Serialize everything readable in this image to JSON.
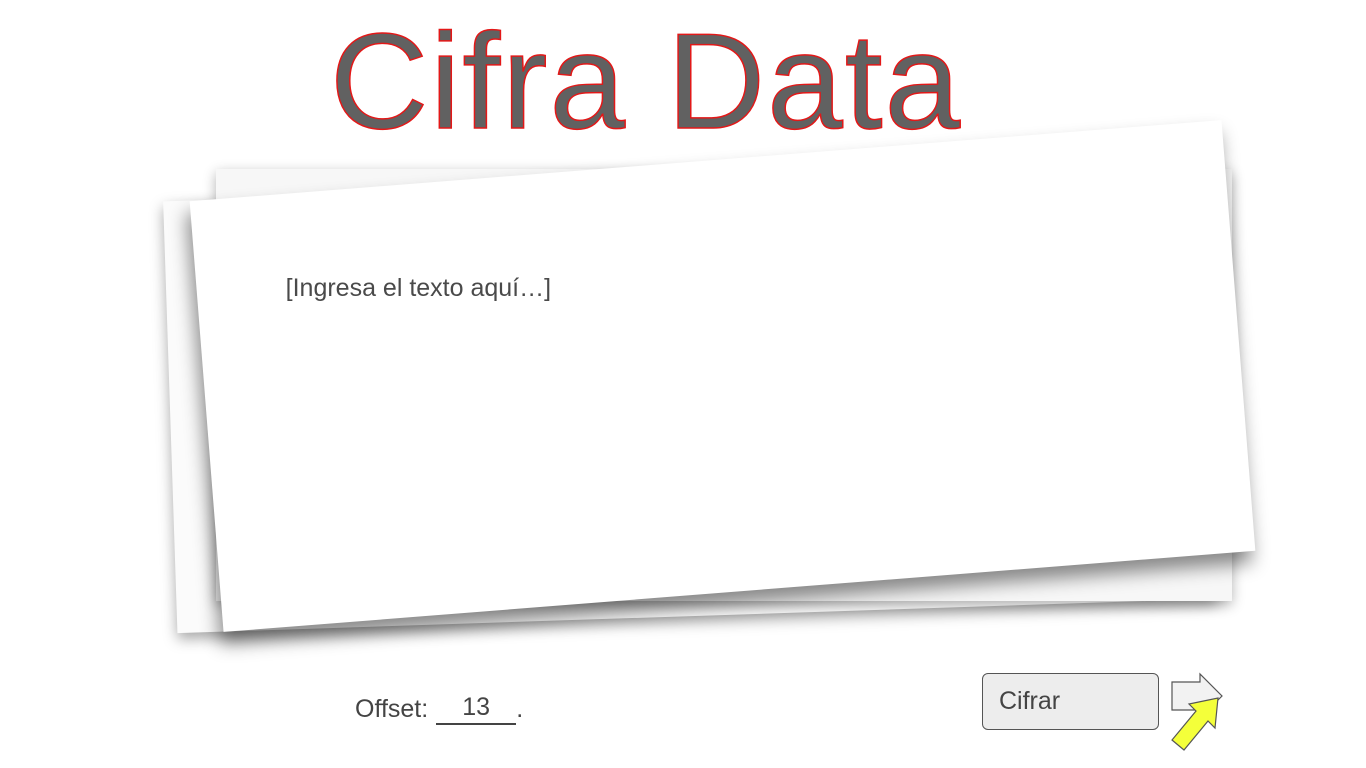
{
  "header": {
    "title": "Cifra Data"
  },
  "editor": {
    "placeholder": "[Ingresa el texto aquí…]",
    "value": ""
  },
  "offset": {
    "label": "Offset:",
    "value": "13"
  },
  "actions": {
    "cipher_label": "Cifrar",
    "arrow_icon": "pointer-arrow-icon",
    "arrow_fill": "#f4ff3a",
    "arrow_secondary_fill": "#f2f2f2"
  },
  "colors": {
    "title_fill": "#616161",
    "title_outline": "#e31818",
    "text": "#444444",
    "button_bg": "#ededed"
  }
}
